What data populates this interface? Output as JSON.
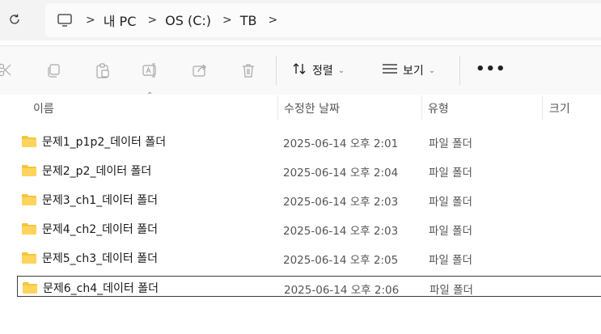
{
  "breadcrumb": {
    "items": [
      "내 PC",
      "OS (C:)",
      "TB"
    ]
  },
  "toolbar": {
    "cut_icon": "scissors-icon",
    "copy_icon": "copy-icon",
    "paste_icon": "paste-icon",
    "rename_icon": "rename-icon",
    "share_icon": "share-icon",
    "delete_icon": "trash-icon",
    "sort_label": "정렬",
    "view_label": "보기",
    "more_label": "•••"
  },
  "columns": {
    "name": "이름",
    "modified": "수정한 날짜",
    "type": "유형",
    "size": "크기"
  },
  "colors": {
    "folder": "#f5c53d",
    "accent": "#0067c0"
  },
  "files": [
    {
      "name": "문제1_p1p2_데이터 폴더",
      "modified": "2025-06-14 오후 2:01",
      "type": "파일 폴더"
    },
    {
      "name": "문제2_p2_데이터 폴더",
      "modified": "2025-06-14 오후 2:04",
      "type": "파일 폴더"
    },
    {
      "name": "문제3_ch1_데이터 폴더",
      "modified": "2025-06-14 오후 2:03",
      "type": "파일 폴더"
    },
    {
      "name": "문제4_ch2_데이터 폴더",
      "modified": "2025-06-14 오후 2:03",
      "type": "파일 폴더"
    },
    {
      "name": "문제5_ch3_데이터 폴더",
      "modified": "2025-06-14 오후 2:05",
      "type": "파일 폴더"
    },
    {
      "name": "문제6_ch4_데이터 폴더",
      "modified": "2025-06-14 오후 2:06",
      "type": "파일 폴더"
    }
  ]
}
